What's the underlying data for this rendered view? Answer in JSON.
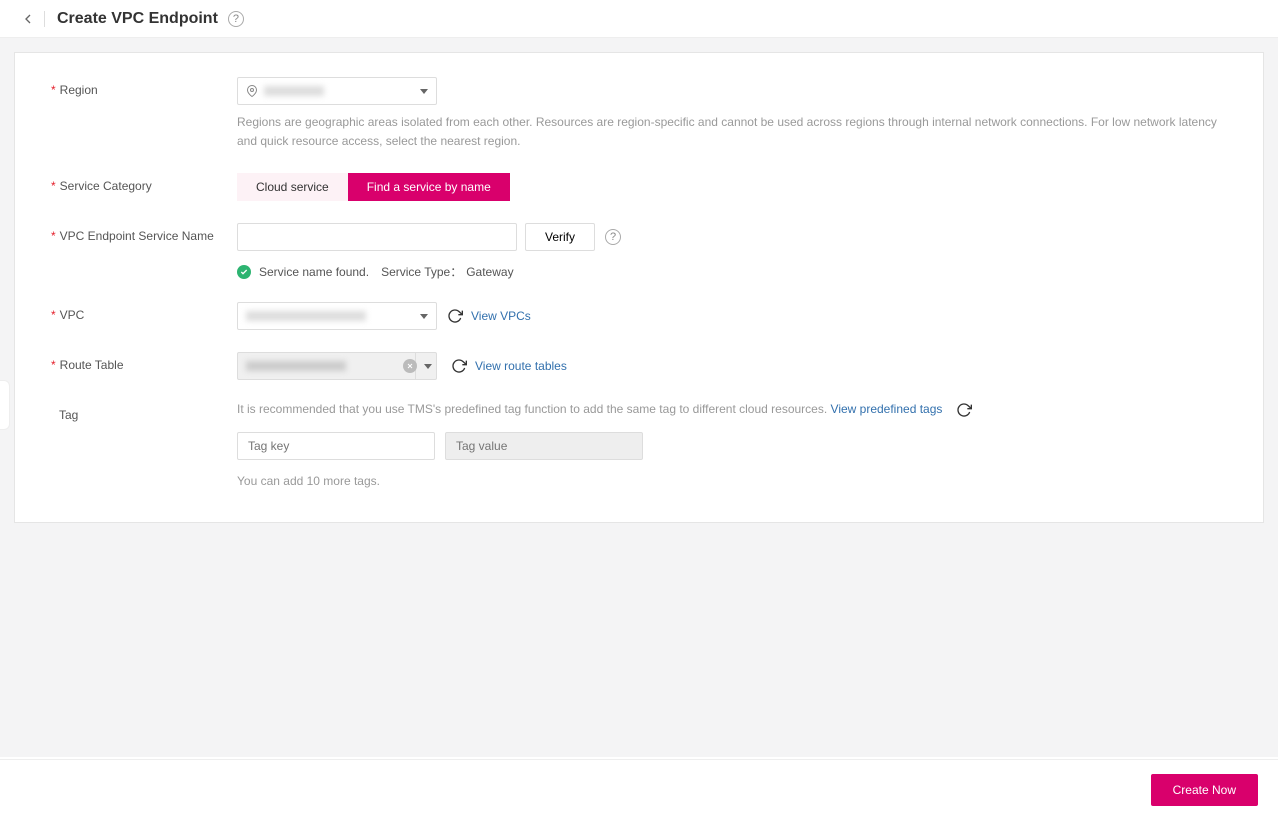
{
  "header": {
    "title": "Create VPC Endpoint"
  },
  "region": {
    "label": "Region",
    "value": "",
    "hint": "Regions are geographic areas isolated from each other. Resources are region-specific and cannot be used across regions through internal network connections. For low network latency and quick resource access, select the nearest region."
  },
  "service_category": {
    "label": "Service Category",
    "options": {
      "cloud": "Cloud service",
      "byname": "Find a service by name"
    }
  },
  "service_name": {
    "label": "VPC Endpoint Service Name",
    "value": "",
    "verify_label": "Verify",
    "status": {
      "found_msg": "Service name found.",
      "type_label": "Service Type：",
      "type_value": "Gateway"
    }
  },
  "vpc": {
    "label": "VPC",
    "value": "",
    "view_link": "View VPCs"
  },
  "route_table": {
    "label": "Route Table",
    "value": "",
    "view_link": "View route tables"
  },
  "tag": {
    "label": "Tag",
    "hint_prefix": "It is recommended that you use TMS's predefined tag function to add the same tag to different cloud resources. ",
    "view_link": "View predefined tags",
    "key_placeholder": "Tag key",
    "value_placeholder": "Tag value",
    "remaining": "You can add 10 more tags."
  },
  "footer": {
    "create_label": "Create Now"
  }
}
